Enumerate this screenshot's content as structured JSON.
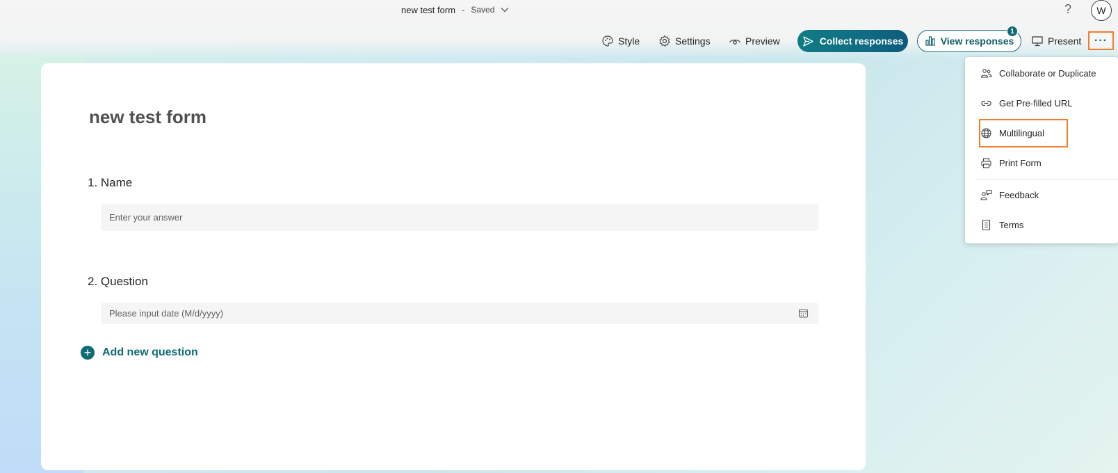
{
  "header": {
    "form_name": "new test form",
    "separator": "-",
    "status": "Saved",
    "help_label": "?",
    "avatar_initial": "W"
  },
  "toolbar": {
    "style_label": "Style",
    "settings_label": "Settings",
    "preview_label": "Preview",
    "collect_label": "Collect responses",
    "view_label": "View responses",
    "view_badge": "1",
    "present_label": "Present",
    "more_label": "···"
  },
  "form": {
    "title": "new test form",
    "questions": [
      {
        "label": "1. Name",
        "placeholder": "Enter your answer"
      },
      {
        "label": "2. Question",
        "placeholder": "Please input date (M/d/yyyy)"
      }
    ],
    "add_question_label": "Add new question"
  },
  "menu": {
    "items": [
      {
        "label": "Collaborate or Duplicate",
        "icon": "people-icon"
      },
      {
        "label": "Get Pre-filled URL",
        "icon": "link-icon"
      },
      {
        "label": "Multilingual",
        "icon": "globe-icon"
      },
      {
        "label": "Print Form",
        "icon": "printer-icon"
      },
      {
        "label": "Feedback",
        "icon": "feedback-icon"
      },
      {
        "label": "Terms",
        "icon": "document-icon"
      }
    ]
  },
  "colors": {
    "accent": "#0f6c77",
    "highlight": "#f07e2e"
  }
}
